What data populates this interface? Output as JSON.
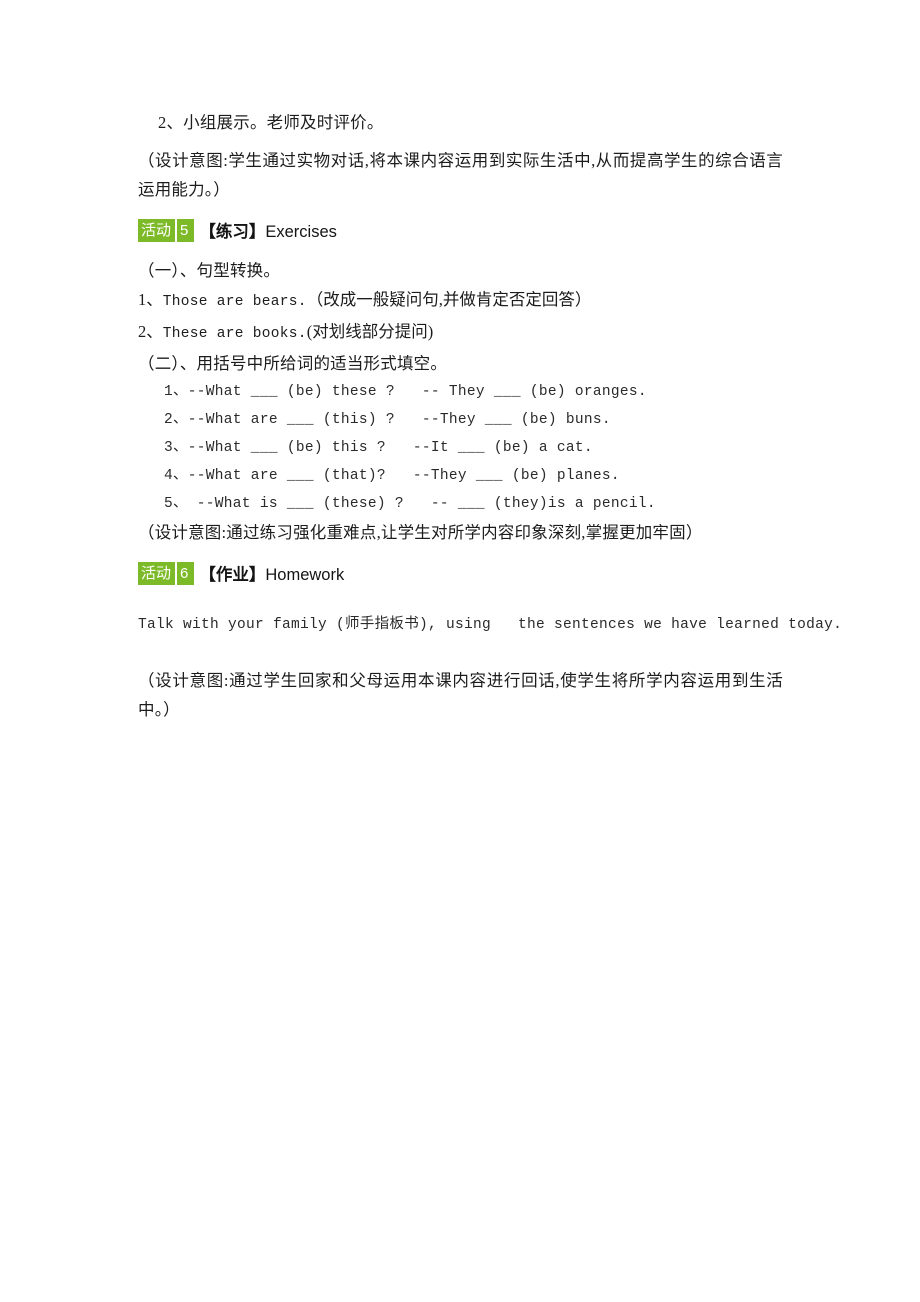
{
  "document": {
    "background_color": "#ffffff",
    "accent_color": "#7DBA28",
    "text_color": "#1c1c1c"
  },
  "content": {
    "group_show_line": "2、小组展示。老师及时评价。",
    "design_note_1": "（设计意图:学生通过实物对话,将本课内容运用到实际生活中,从而提高学生的综合语言运用能力。）",
    "activity5": {
      "badge_word": "活动",
      "badge_number": "5",
      "title_cjk": "【练习】",
      "title_en": "Exercises"
    },
    "section_one_title": "（一）、句型转换。",
    "section_one_items": [
      {
        "num": "1、",
        "en": "Those are bears.",
        "cjk": "（改成一般疑问句,并做肯定否定回答）"
      },
      {
        "num": "2、",
        "en": "These are books.",
        "cjk": "(对划线部分提问)"
      }
    ],
    "section_two_title": "（二）、用括号中所给词的适当形式填空。",
    "section_two_items": [
      "1、--What ___ (be) these ?   -- They ___ (be) oranges.",
      "2、--What are ___ (this) ?   --They ___ (be) buns.",
      "3、--What ___ (be) this ?   --It ___ (be) a cat.",
      "4、--What are ___ (that)?   --They ___ (be) planes.",
      "5、 --What is ___ (these) ?   -- ___ (they)is a pencil."
    ],
    "design_note_2": "（设计意图:通过练习强化重难点,让学生对所学内容印象深刻,掌握更加牢固）",
    "activity6": {
      "badge_word": "活动",
      "badge_number": "6",
      "title_cjk": "【作业】",
      "title_en": "Homework"
    },
    "homework_line": "Talk with your family (师手指板书), using   the sentences we have learned today.",
    "design_note_3": "（设计意图:通过学生回家和父母运用本课内容进行回话,使学生将所学内容运用到生活中。）"
  }
}
